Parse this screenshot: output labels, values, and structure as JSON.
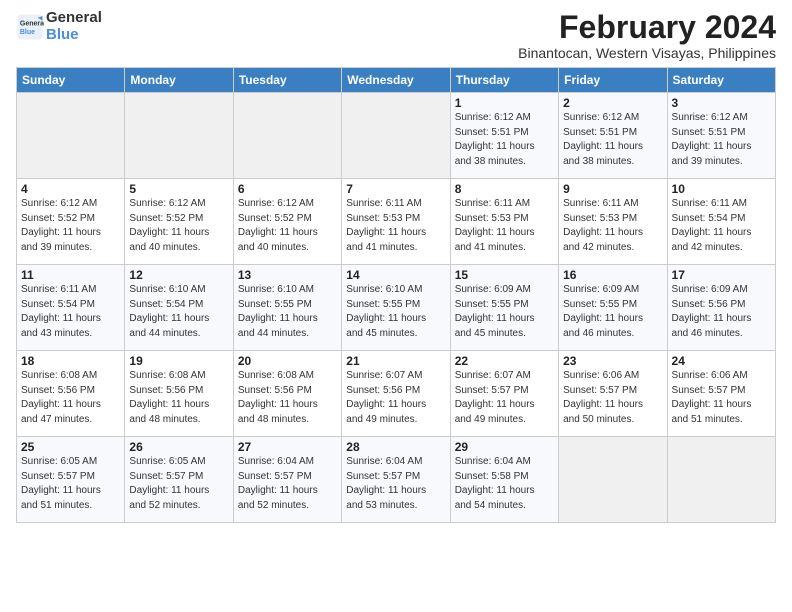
{
  "logo": {
    "line1": "General",
    "line2": "Blue"
  },
  "header": {
    "month": "February 2024",
    "location": "Binantocan, Western Visayas, Philippines"
  },
  "weekdays": [
    "Sunday",
    "Monday",
    "Tuesday",
    "Wednesday",
    "Thursday",
    "Friday",
    "Saturday"
  ],
  "weeks": [
    [
      {
        "day": "",
        "info": ""
      },
      {
        "day": "",
        "info": ""
      },
      {
        "day": "",
        "info": ""
      },
      {
        "day": "",
        "info": ""
      },
      {
        "day": "1",
        "info": "Sunrise: 6:12 AM\nSunset: 5:51 PM\nDaylight: 11 hours\nand 38 minutes."
      },
      {
        "day": "2",
        "info": "Sunrise: 6:12 AM\nSunset: 5:51 PM\nDaylight: 11 hours\nand 38 minutes."
      },
      {
        "day": "3",
        "info": "Sunrise: 6:12 AM\nSunset: 5:51 PM\nDaylight: 11 hours\nand 39 minutes."
      }
    ],
    [
      {
        "day": "4",
        "info": "Sunrise: 6:12 AM\nSunset: 5:52 PM\nDaylight: 11 hours\nand 39 minutes."
      },
      {
        "day": "5",
        "info": "Sunrise: 6:12 AM\nSunset: 5:52 PM\nDaylight: 11 hours\nand 40 minutes."
      },
      {
        "day": "6",
        "info": "Sunrise: 6:12 AM\nSunset: 5:52 PM\nDaylight: 11 hours\nand 40 minutes."
      },
      {
        "day": "7",
        "info": "Sunrise: 6:11 AM\nSunset: 5:53 PM\nDaylight: 11 hours\nand 41 minutes."
      },
      {
        "day": "8",
        "info": "Sunrise: 6:11 AM\nSunset: 5:53 PM\nDaylight: 11 hours\nand 41 minutes."
      },
      {
        "day": "9",
        "info": "Sunrise: 6:11 AM\nSunset: 5:53 PM\nDaylight: 11 hours\nand 42 minutes."
      },
      {
        "day": "10",
        "info": "Sunrise: 6:11 AM\nSunset: 5:54 PM\nDaylight: 11 hours\nand 42 minutes."
      }
    ],
    [
      {
        "day": "11",
        "info": "Sunrise: 6:11 AM\nSunset: 5:54 PM\nDaylight: 11 hours\nand 43 minutes."
      },
      {
        "day": "12",
        "info": "Sunrise: 6:10 AM\nSunset: 5:54 PM\nDaylight: 11 hours\nand 44 minutes."
      },
      {
        "day": "13",
        "info": "Sunrise: 6:10 AM\nSunset: 5:55 PM\nDaylight: 11 hours\nand 44 minutes."
      },
      {
        "day": "14",
        "info": "Sunrise: 6:10 AM\nSunset: 5:55 PM\nDaylight: 11 hours\nand 45 minutes."
      },
      {
        "day": "15",
        "info": "Sunrise: 6:09 AM\nSunset: 5:55 PM\nDaylight: 11 hours\nand 45 minutes."
      },
      {
        "day": "16",
        "info": "Sunrise: 6:09 AM\nSunset: 5:55 PM\nDaylight: 11 hours\nand 46 minutes."
      },
      {
        "day": "17",
        "info": "Sunrise: 6:09 AM\nSunset: 5:56 PM\nDaylight: 11 hours\nand 46 minutes."
      }
    ],
    [
      {
        "day": "18",
        "info": "Sunrise: 6:08 AM\nSunset: 5:56 PM\nDaylight: 11 hours\nand 47 minutes."
      },
      {
        "day": "19",
        "info": "Sunrise: 6:08 AM\nSunset: 5:56 PM\nDaylight: 11 hours\nand 48 minutes."
      },
      {
        "day": "20",
        "info": "Sunrise: 6:08 AM\nSunset: 5:56 PM\nDaylight: 11 hours\nand 48 minutes."
      },
      {
        "day": "21",
        "info": "Sunrise: 6:07 AM\nSunset: 5:56 PM\nDaylight: 11 hours\nand 49 minutes."
      },
      {
        "day": "22",
        "info": "Sunrise: 6:07 AM\nSunset: 5:57 PM\nDaylight: 11 hours\nand 49 minutes."
      },
      {
        "day": "23",
        "info": "Sunrise: 6:06 AM\nSunset: 5:57 PM\nDaylight: 11 hours\nand 50 minutes."
      },
      {
        "day": "24",
        "info": "Sunrise: 6:06 AM\nSunset: 5:57 PM\nDaylight: 11 hours\nand 51 minutes."
      }
    ],
    [
      {
        "day": "25",
        "info": "Sunrise: 6:05 AM\nSunset: 5:57 PM\nDaylight: 11 hours\nand 51 minutes."
      },
      {
        "day": "26",
        "info": "Sunrise: 6:05 AM\nSunset: 5:57 PM\nDaylight: 11 hours\nand 52 minutes."
      },
      {
        "day": "27",
        "info": "Sunrise: 6:04 AM\nSunset: 5:57 PM\nDaylight: 11 hours\nand 52 minutes."
      },
      {
        "day": "28",
        "info": "Sunrise: 6:04 AM\nSunset: 5:57 PM\nDaylight: 11 hours\nand 53 minutes."
      },
      {
        "day": "29",
        "info": "Sunrise: 6:04 AM\nSunset: 5:58 PM\nDaylight: 11 hours\nand 54 minutes."
      },
      {
        "day": "",
        "info": ""
      },
      {
        "day": "",
        "info": ""
      }
    ]
  ]
}
